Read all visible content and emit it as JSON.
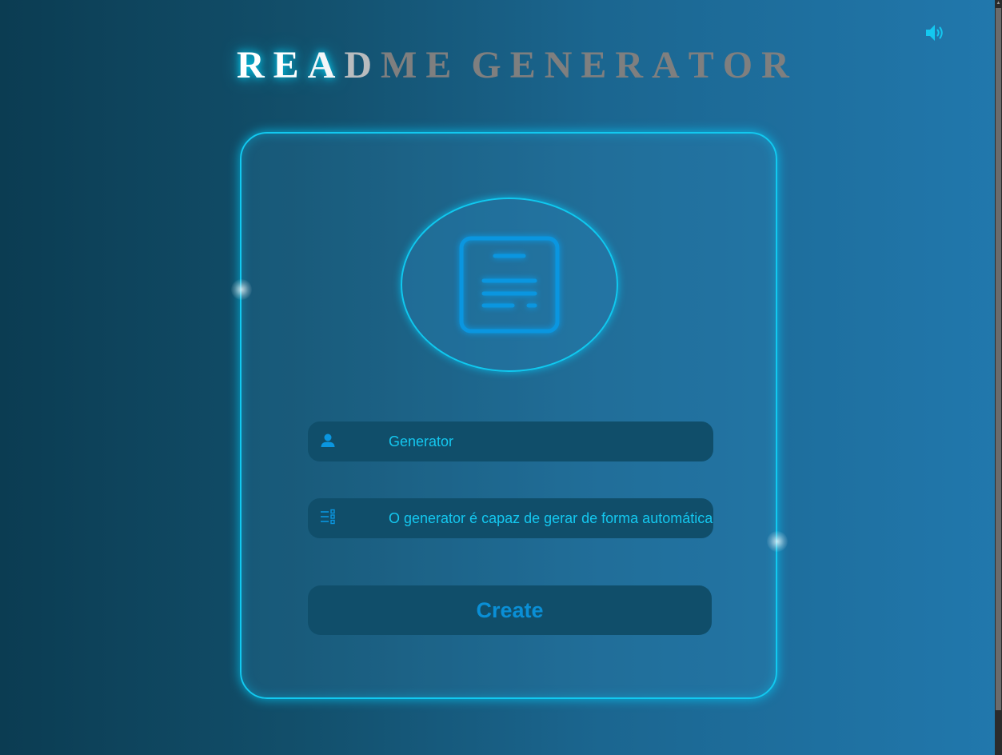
{
  "header": {
    "title_letters": [
      {
        "char": "R",
        "color": "#ffffff",
        "glow": true
      },
      {
        "char": "E",
        "color": "#ffffff",
        "glow": true
      },
      {
        "char": "A",
        "color": "#f2f6f8",
        "glow": true
      },
      {
        "char": "D",
        "color": "#b9bcbe",
        "glow": false
      },
      {
        "char": "M",
        "color": "#7f7f7f",
        "glow": false
      },
      {
        "char": "E",
        "color": "#7f7f7f",
        "glow": false
      },
      {
        "char": " ",
        "color": "#7f7f7f",
        "glow": false
      },
      {
        "char": "G",
        "color": "#7f7f7f",
        "glow": false
      },
      {
        "char": "E",
        "color": "#7f7f7f",
        "glow": false
      },
      {
        "char": "N",
        "color": "#7f7f7f",
        "glow": false
      },
      {
        "char": "E",
        "color": "#7f7f7f",
        "glow": false
      },
      {
        "char": "R",
        "color": "#7f7f7f",
        "glow": false
      },
      {
        "char": "A",
        "color": "#7f7f7f",
        "glow": false
      },
      {
        "char": "T",
        "color": "#7f7f7f",
        "glow": false
      },
      {
        "char": "O",
        "color": "#7f7f7f",
        "glow": false
      },
      {
        "char": "R",
        "color": "#7f7f7f",
        "glow": false
      }
    ],
    "sound_icon": "speaker-volume-icon"
  },
  "form": {
    "logo_icon": "document-icon",
    "name_field": {
      "icon": "user-icon",
      "value": "Generator"
    },
    "description_field": {
      "icon": "list-details-icon",
      "value": "O generator é capaz de gerar de forma automática"
    },
    "create_label": "Create"
  },
  "colors": {
    "accent": "#12c9f0",
    "icon_blue": "#0a96e0",
    "field_bg": "#104e6a",
    "title_dim": "#7f7f7f"
  }
}
